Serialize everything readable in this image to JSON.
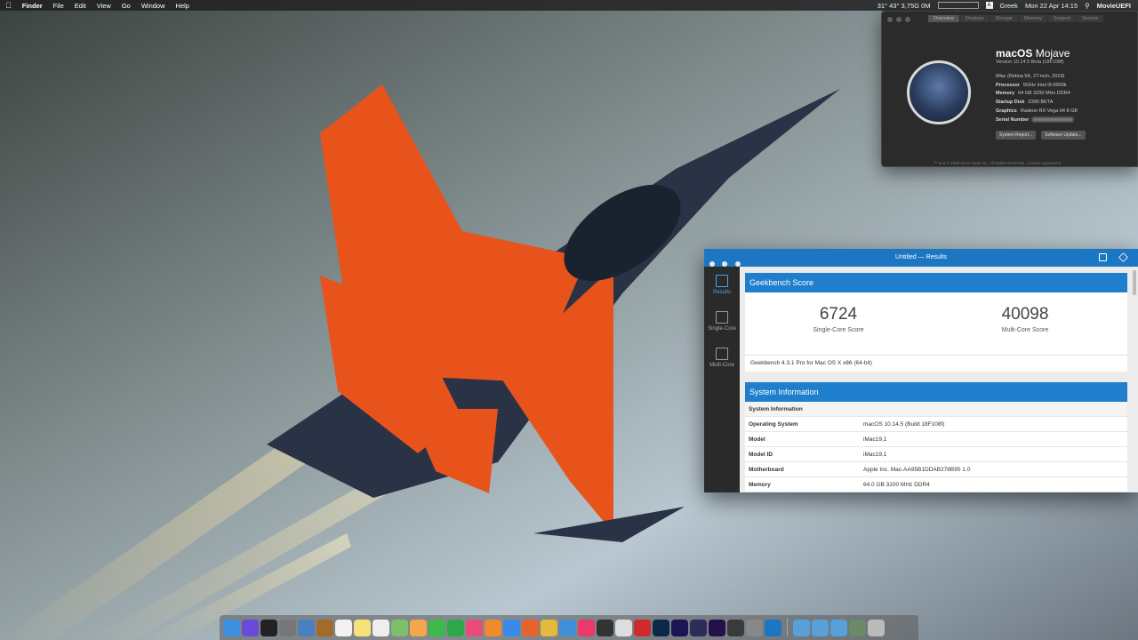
{
  "menubar": {
    "app": "Finder",
    "menus": [
      "File",
      "Edit",
      "View",
      "Go",
      "Window",
      "Help"
    ],
    "cpu_temp": "31° 43° 3,75G 0M",
    "lang": "Greek",
    "clock": "Mon 22 Apr  14:15",
    "user": "MovieUEFI"
  },
  "about": {
    "tabs": [
      "Overview",
      "Displays",
      "Storage",
      "Memory",
      "Support",
      "Service"
    ],
    "os_name_bold": "macOS",
    "os_name_light": "Mojave",
    "version": "Version 10.14.5 Beta (18F108f)",
    "specs": [
      {
        "k": "",
        "v": "iMac (Retina 5K, 27-inch, 2019)"
      },
      {
        "k": "Processor",
        "v": "5GHz Intel i9-9900k"
      },
      {
        "k": "Memory",
        "v": "64 GB 3200 MHz DDR4"
      },
      {
        "k": "Startup Disk",
        "v": "Z390 BETA"
      },
      {
        "k": "Graphics",
        "v": "Radeon RX Vega 64 8 GB"
      },
      {
        "k": "Serial Number",
        "v": ""
      }
    ],
    "btn_report": "System Report...",
    "btn_update": "Software Update...",
    "legal": "™ and © 1983-2019 Apple Inc. All Rights Reserved. License Agreement"
  },
  "geekbench": {
    "title": "Untitled — Results",
    "sidebar": [
      "Results",
      "Single-Core",
      "Multi-Core"
    ],
    "score_header": "Geekbench Score",
    "single_score": "6724",
    "single_label": "Single-Core Score",
    "multi_score": "40098",
    "multi_label": "Multi-Core Score",
    "version_line": "Geekbench 4.3.1 Pro for Mac OS X x86 (64-bit)",
    "sysinfo_header": "System Information",
    "sysinfo_sub": "System Information",
    "rows": [
      {
        "k": "Operating System",
        "v": "macOS 10.14.5 (Build 18F108f)"
      },
      {
        "k": "Model",
        "v": "iMac19,1"
      },
      {
        "k": "Model ID",
        "v": "iMac19,1"
      },
      {
        "k": "Motherboard",
        "v": "Apple Inc. Mac-AA95B1DDAB278B95 1.0"
      },
      {
        "k": "Memory",
        "v": "64.0 GB 3200 MHz DDR4"
      }
    ]
  },
  "dock": {
    "icons": [
      {
        "name": "finder-icon",
        "color": "#3d8fe0"
      },
      {
        "name": "siri-icon",
        "color": "#6a4ad8"
      },
      {
        "name": "dashboard-icon",
        "color": "#222"
      },
      {
        "name": "launchpad-icon",
        "color": "#777"
      },
      {
        "name": "preview-icon",
        "color": "#4b7fbf"
      },
      {
        "name": "notes-book-icon",
        "color": "#a36a2a"
      },
      {
        "name": "calendar-icon",
        "color": "#f2f2f2"
      },
      {
        "name": "notes-icon",
        "color": "#f7e27a"
      },
      {
        "name": "reminders-icon",
        "color": "#eee"
      },
      {
        "name": "maps-icon",
        "color": "#7dbf6a"
      },
      {
        "name": "photos-icon",
        "color": "#f3a64a"
      },
      {
        "name": "messages-icon",
        "color": "#3db84a"
      },
      {
        "name": "facetime-icon",
        "color": "#2ea84a"
      },
      {
        "name": "itunes-icon",
        "color": "#e94c7a"
      },
      {
        "name": "ibooks-icon",
        "color": "#f08b2c"
      },
      {
        "name": "appstore-icon",
        "color": "#3a8be8"
      },
      {
        "name": "firefox-icon",
        "color": "#e8622c"
      },
      {
        "name": "chrome-icon",
        "color": "#e5b93b"
      },
      {
        "name": "safari-icon",
        "color": "#3f8fd9"
      },
      {
        "name": "tweetbot-icon",
        "color": "#e93a6a"
      },
      {
        "name": "davinci-icon",
        "color": "#333"
      },
      {
        "name": "compressor-icon",
        "color": "#ddd"
      },
      {
        "name": "opera-icon",
        "color": "#d02a2a"
      },
      {
        "name": "photoshop-icon",
        "color": "#0b2a4a"
      },
      {
        "name": "aftereffects-icon",
        "color": "#1d1553"
      },
      {
        "name": "motion-icon",
        "color": "#2d2d5a"
      },
      {
        "name": "premiere-icon",
        "color": "#24114a"
      },
      {
        "name": "fcp-icon",
        "color": "#3a3a3a"
      },
      {
        "name": "sysprefs-icon",
        "color": "#888"
      },
      {
        "name": "geekbench-icon",
        "color": "#1c77c3"
      }
    ],
    "right": [
      {
        "name": "apps-folder-icon",
        "color": "#5aa0d8"
      },
      {
        "name": "downloads-icon",
        "color": "#5aa0d8"
      },
      {
        "name": "docs-folder-icon",
        "color": "#5aa0d8"
      },
      {
        "name": "stack-icon",
        "color": "#6a8a6a"
      },
      {
        "name": "trash-icon",
        "color": "#bbb"
      }
    ]
  }
}
